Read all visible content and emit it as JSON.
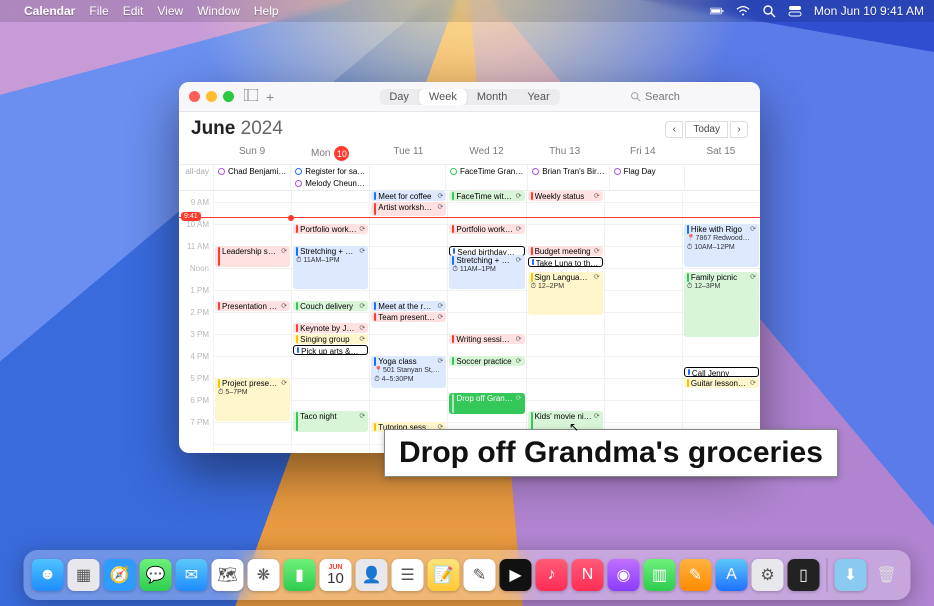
{
  "menubar": {
    "app": "Calendar",
    "items": [
      "File",
      "Edit",
      "View",
      "Window",
      "Help"
    ],
    "clock": "Mon Jun 10  9:41 AM"
  },
  "window": {
    "views": [
      "Day",
      "Week",
      "Month",
      "Year"
    ],
    "active_view": "Week",
    "search_placeholder": "Search",
    "month": "June",
    "year": "2024",
    "today_btn": "Today",
    "allday_label": "all-day",
    "now_time": "9:41",
    "days": [
      {
        "label": "Sun 9",
        "today": false
      },
      {
        "label": "Mon",
        "num": "10",
        "today": true
      },
      {
        "label": "Tue 11",
        "today": false
      },
      {
        "label": "Wed 12",
        "today": false
      },
      {
        "label": "Thu 13",
        "today": false
      },
      {
        "label": "Fri 14",
        "today": false
      },
      {
        "label": "Sat 15",
        "today": false
      }
    ],
    "hours": [
      "9 AM",
      "10 AM",
      "11 AM",
      "Noon",
      "1 PM",
      "2 PM",
      "3 PM",
      "4 PM",
      "5 PM",
      "6 PM",
      "7 PM"
    ],
    "allday_events": {
      "0": [
        {
          "title": "Chad Benjami…",
          "color": "purple",
          "outline": true
        }
      ],
      "1": [
        {
          "title": "Register for sa…",
          "color": "blue",
          "outline": true
        },
        {
          "title": "Melody Cheun…",
          "color": "purple",
          "outline": true
        }
      ],
      "3": [
        {
          "title": "FaceTime Gran…",
          "color": "green",
          "outline": true
        }
      ],
      "4": [
        {
          "title": "Brian Tran's Bir…",
          "color": "purple",
          "outline": true
        }
      ],
      "5": [
        {
          "title": "Flag Day",
          "color": "purple",
          "outline": true
        }
      ]
    },
    "events": {
      "0": [
        {
          "title": "Leadership skil…",
          "start": 11,
          "dur": 1,
          "color": "red",
          "rpt": true
        },
        {
          "title": "Presentation p…",
          "start": 13.5,
          "dur": 0.5,
          "color": "red",
          "rpt": true
        },
        {
          "title": "Project presentations",
          "sub": "⏱ 5–7PM",
          "start": 17,
          "dur": 2,
          "color": "yellow",
          "rpt": true
        }
      ],
      "1": [
        {
          "title": "Portfolio work…",
          "start": 10,
          "dur": 0.5,
          "color": "red",
          "rpt": true
        },
        {
          "title": "Stretching + weights",
          "sub": "⏱ 11AM–1PM",
          "start": 11,
          "dur": 2,
          "color": "blue",
          "rpt": true
        },
        {
          "title": "Couch delivery",
          "start": 13.5,
          "dur": 0.5,
          "color": "green",
          "rpt": true
        },
        {
          "title": "Keynote by Ja…",
          "start": 14.5,
          "dur": 0.5,
          "color": "red",
          "rpt": true
        },
        {
          "title": "Singing group",
          "start": 15,
          "dur": 0.5,
          "color": "yellow",
          "rpt": true
        },
        {
          "title": "Pick up arts &…",
          "start": 15.5,
          "dur": 0.5,
          "color": "blue",
          "hollow": true
        },
        {
          "title": "Taco night",
          "start": 18.5,
          "dur": 1,
          "color": "green",
          "rpt": true
        }
      ],
      "2": [
        {
          "title": "Meet for coffee",
          "start": 8.5,
          "dur": 0.5,
          "color": "blue",
          "rpt": true
        },
        {
          "title": "Artist worksho…",
          "start": 9,
          "dur": 0.7,
          "color": "red",
          "rpt": true
        },
        {
          "title": "Meet at the res…",
          "start": 13.5,
          "dur": 0.5,
          "color": "blue",
          "rpt": true
        },
        {
          "title": "Team presenta…",
          "start": 14,
          "dur": 0.5,
          "color": "red",
          "rpt": true
        },
        {
          "title": "Yoga class",
          "sub": "📍501 Stanyan St,…\n⏱ 4–5:30PM",
          "start": 16,
          "dur": 1.5,
          "color": "blue",
          "rpt": true
        },
        {
          "title": "Tutoring session",
          "start": 19,
          "dur": 0.5,
          "color": "yellow",
          "rpt": true
        }
      ],
      "3": [
        {
          "title": "FaceTime with…",
          "start": 8.5,
          "dur": 0.5,
          "color": "green",
          "rpt": true
        },
        {
          "title": "Portfolio work…",
          "start": 10,
          "dur": 0.5,
          "color": "red",
          "rpt": true
        },
        {
          "title": "Send birthday…",
          "start": 11,
          "dur": 0.5,
          "color": "blue",
          "hollow": true
        },
        {
          "title": "Stretching + weights",
          "sub": "⏱ 11AM–1PM",
          "start": 11.4,
          "dur": 1.6,
          "color": "blue",
          "rpt": true
        },
        {
          "title": "Writing sessio…",
          "start": 15,
          "dur": 0.5,
          "color": "red",
          "rpt": true
        },
        {
          "title": "Soccer practice",
          "start": 16,
          "dur": 0.5,
          "color": "green",
          "rpt": true
        },
        {
          "title": "Drop off Grandma's groceries",
          "start": 17.7,
          "dur": 1,
          "color": "greenS",
          "rpt": true,
          "selected": true
        }
      ],
      "4": [
        {
          "title": "Weekly status",
          "start": 8.5,
          "dur": 0.5,
          "color": "red",
          "rpt": true
        },
        {
          "title": "Budget meeting",
          "start": 11,
          "dur": 0.5,
          "color": "red",
          "rpt": true
        },
        {
          "title": "Take Luna to th…",
          "start": 11.5,
          "dur": 0.5,
          "color": "blue",
          "hollow": true
        },
        {
          "title": "Sign Language Club",
          "sub": "⏱ 12–2PM",
          "start": 12.2,
          "dur": 2,
          "color": "yellow",
          "rpt": true
        },
        {
          "title": "Kids' movie night",
          "start": 18.5,
          "dur": 1,
          "color": "green",
          "rpt": true
        }
      ],
      "5": [],
      "6": [
        {
          "title": "Hike with Rigo",
          "sub": "📍7867 Redwood…\n⏱ 10AM–12PM",
          "start": 10,
          "dur": 2,
          "color": "blue",
          "rpt": true
        },
        {
          "title": "Family picnic",
          "sub": "⏱ 12–3PM",
          "start": 12.2,
          "dur": 3,
          "color": "green",
          "rpt": true
        },
        {
          "title": "Call Jenny",
          "start": 16.5,
          "dur": 0.5,
          "color": "blue",
          "hollow": true
        },
        {
          "title": "Guitar lessons…",
          "start": 17,
          "dur": 0.5,
          "color": "yellow",
          "rpt": true
        }
      ]
    }
  },
  "callout": "Drop off Grandma's groceries",
  "dock": {
    "cal_month": "JUN",
    "cal_day": "10",
    "icons": [
      {
        "name": "finder",
        "bg": "linear-gradient(#4ec3ff,#1f8cff)",
        "glyph": "☻"
      },
      {
        "name": "launchpad",
        "bg": "#e8e8ec",
        "glyph": "▦"
      },
      {
        "name": "safari",
        "bg": "radial-gradient(#fff 30%,#2e9bff 32%)",
        "glyph": "🧭"
      },
      {
        "name": "messages",
        "bg": "linear-gradient(#6ef07a,#2ecc4f)",
        "glyph": "💬"
      },
      {
        "name": "mail",
        "bg": "linear-gradient(#5ac8fa,#1f8cff)",
        "glyph": "✉︎"
      },
      {
        "name": "maps",
        "bg": "#fff",
        "glyph": "🗺"
      },
      {
        "name": "photos",
        "bg": "#fff",
        "glyph": "❋"
      },
      {
        "name": "facetime",
        "bg": "linear-gradient(#6ef07a,#2ecc4f)",
        "glyph": "▮"
      },
      {
        "name": "calendar",
        "cal": true
      },
      {
        "name": "contacts",
        "bg": "#e8e8ec",
        "glyph": "👤"
      },
      {
        "name": "reminders",
        "bg": "#fff",
        "glyph": "☰"
      },
      {
        "name": "notes",
        "bg": "linear-gradient(#ffe37a,#ffc933)",
        "glyph": "📝"
      },
      {
        "name": "freeform",
        "bg": "#fff",
        "glyph": "✎"
      },
      {
        "name": "tv",
        "bg": "#111",
        "glyph": "▶︎"
      },
      {
        "name": "music",
        "bg": "linear-gradient(#ff5b77,#ff2d55)",
        "glyph": "♪"
      },
      {
        "name": "news",
        "bg": "linear-gradient(#ff5b77,#ff2d55)",
        "glyph": "N"
      },
      {
        "name": "podcasts",
        "bg": "linear-gradient(#c070ff,#8a3cff)",
        "glyph": "◉"
      },
      {
        "name": "numbers",
        "bg": "linear-gradient(#6ef07a,#2ecc4f)",
        "glyph": "▥"
      },
      {
        "name": "pages",
        "bg": "linear-gradient(#ffb340,#ff8a00)",
        "glyph": "✎"
      },
      {
        "name": "appstore",
        "bg": "linear-gradient(#5ac8fa,#1f6fff)",
        "glyph": "A"
      },
      {
        "name": "settings",
        "bg": "#e8e8ec",
        "glyph": "⚙︎"
      },
      {
        "name": "iphone-mirroring",
        "bg": "#222",
        "glyph": "▯"
      }
    ],
    "right": [
      {
        "name": "downloads",
        "bg": "#8ac9f0",
        "glyph": "⬇︎"
      },
      {
        "name": "trash",
        "bg": "transparent",
        "glyph": "🗑"
      }
    ]
  }
}
